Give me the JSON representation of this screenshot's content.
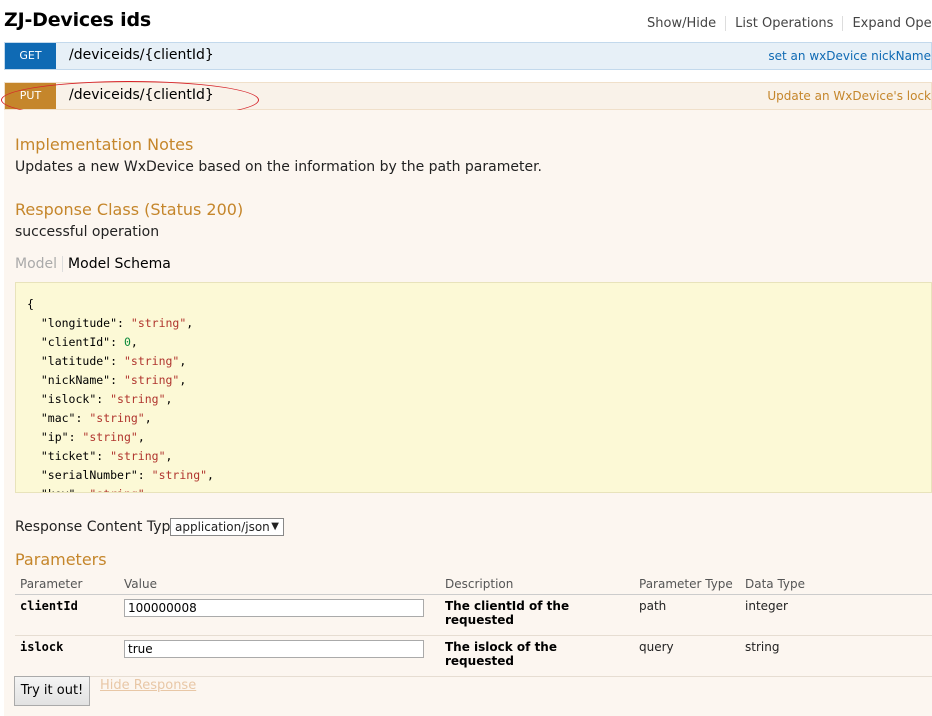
{
  "resource": {
    "title": "ZJ-Devices ids",
    "links": [
      "Show/Hide",
      "List Operations",
      "Expand Operations"
    ]
  },
  "operations": {
    "get": {
      "method": "GET",
      "path": "/deviceids/{clientId}",
      "summary": "set an wxDevice nickName"
    },
    "put": {
      "method": "PUT",
      "path": "/deviceids/{clientId}",
      "summary": "Update an WxDevice's lock"
    }
  },
  "put_body": {
    "impl_heading": "Implementation Notes",
    "impl_text": "Updates a new WxDevice based on the information by the path parameter.",
    "response_heading": "Response Class (Status 200)",
    "response_text": "successful operation",
    "tabs": {
      "model": "Model",
      "schema": "Model Schema"
    },
    "schema_fields": [
      {
        "key": "longitude",
        "value": "\"string\"",
        "type": "string"
      },
      {
        "key": "clientId",
        "value": "0",
        "type": "number"
      },
      {
        "key": "latitude",
        "value": "\"string\"",
        "type": "string"
      },
      {
        "key": "nickName",
        "value": "\"string\"",
        "type": "string"
      },
      {
        "key": "islock",
        "value": "\"string\"",
        "type": "string"
      },
      {
        "key": "mac",
        "value": "\"string\"",
        "type": "string"
      },
      {
        "key": "ip",
        "value": "\"string\"",
        "type": "string"
      },
      {
        "key": "ticket",
        "value": "\"string\"",
        "type": "string"
      },
      {
        "key": "serialNumber",
        "value": "\"string\"",
        "type": "string"
      },
      {
        "key": "key",
        "value": "\"string\"",
        "type": "string"
      }
    ],
    "response_content_type_label": "Response Content Type",
    "response_content_type_value": "application/json",
    "parameters_heading": "Parameters",
    "param_columns": [
      "Parameter",
      "Value",
      "Description",
      "Parameter Type",
      "Data Type"
    ],
    "params": [
      {
        "name": "clientId",
        "value": "100000008",
        "description": "The clientId of the requested",
        "param_type": "path",
        "data_type": "integer"
      },
      {
        "name": "islock",
        "value": "true",
        "description": "The islock of the requested",
        "param_type": "query",
        "data_type": "string"
      }
    ],
    "try_button": "Try it out!",
    "hide_response": "Hide Response"
  },
  "colors": {
    "get": "#0f6ab4",
    "put": "#c5862b",
    "annotation": "#d6242b"
  }
}
